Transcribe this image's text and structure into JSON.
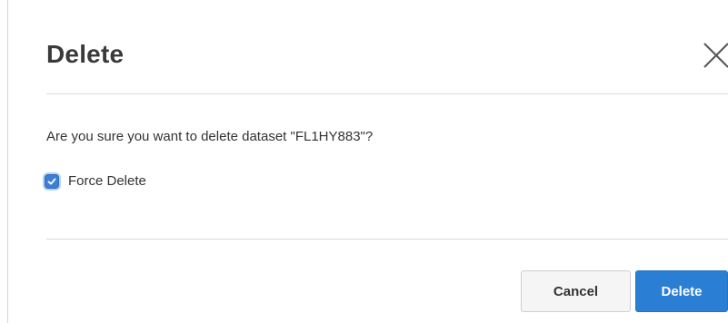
{
  "dialog": {
    "title": "Delete",
    "message": "Are you sure you want to delete dataset \"FL1HY883\"?",
    "close_icon": "close-icon",
    "force_delete": {
      "label": "Force Delete",
      "checked": true,
      "icon": "checkmark-icon"
    },
    "buttons": {
      "cancel_label": "Cancel",
      "delete_label": "Delete"
    }
  },
  "colors": {
    "primary": "#2a7fd4",
    "checkbox": "#3d7fd6",
    "title_text": "#3a3a3a",
    "divider": "#d9d9d9"
  }
}
